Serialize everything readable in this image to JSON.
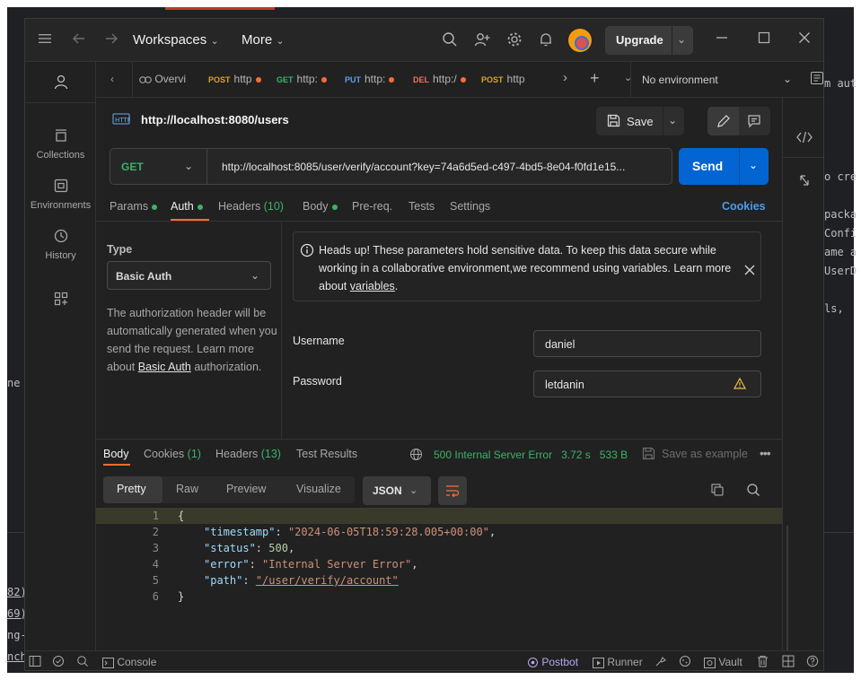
{
  "background_ide": {
    "fragments": [
      "m aut",
      "o cre",
      "packa",
      "Confi",
      "ame a",
      "UserD",
      "ls,",
      "ne",
      "82)",
      "69)",
      "ng-",
      "nch"
    ]
  },
  "titlebar": {
    "workspaces_label": "Workspaces",
    "more_label": "More",
    "upgrade_label": "Upgrade"
  },
  "sidebar": {
    "items": [
      {
        "label": "Collections",
        "icon": "collections-icon"
      },
      {
        "label": "Environments",
        "icon": "environments-icon"
      },
      {
        "label": "History",
        "icon": "history-icon"
      }
    ]
  },
  "tabs": [
    {
      "label": "Overvi",
      "method": ""
    },
    {
      "method": "POST",
      "label": "http",
      "method_color": "#d7a42a"
    },
    {
      "method": "GET",
      "label": "http:",
      "method_color": "#3bb36b"
    },
    {
      "method": "PUT",
      "label": "http:",
      "method_color": "#5f9fe8"
    },
    {
      "method": "DEL",
      "label": "http:/",
      "method_color": "#e8735f"
    },
    {
      "method": "POST",
      "label": "http",
      "method_color": "#d7a42a"
    }
  ],
  "environment": {
    "selected": "No environment"
  },
  "request": {
    "name": "http://localhost:8080/users",
    "method": "GET",
    "url": "http://localhost:8085/user/verify/account?key=74a6d5ed-c497-4bd5-8e04-f0fd1e15...",
    "save_label": "Save",
    "send_label": "Send"
  },
  "request_tabs": {
    "params": "Params",
    "auth": "Auth",
    "headers": "Headers",
    "headers_count": "(10)",
    "body": "Body",
    "prereq": "Pre-req.",
    "tests": "Tests",
    "settings": "Settings",
    "cookies": "Cookies"
  },
  "auth": {
    "type_label": "Type",
    "type_value": "Basic Auth",
    "desc_prefix": "The authorization header will be automatically generated when you send the request. Learn more about ",
    "desc_link": "Basic Auth",
    "desc_suffix": " authorization.",
    "warning_text": "Heads up! These parameters hold sensitive data. To keep this data secure while working in a collaborative environment,we recommend using variables. Learn more about ",
    "warning_link": "variables",
    "warning_end": ".",
    "username_label": "Username",
    "username_value": "daniel",
    "password_label": "Password",
    "password_value": "letdanin"
  },
  "response": {
    "tabs": {
      "body": "Body",
      "cookies": "Cookies",
      "cookies_count": "(1)",
      "headers": "Headers",
      "headers_count": "(13)",
      "test_results": "Test Results"
    },
    "status": "500 Internal Server Error",
    "time": "3.72 s",
    "size": "533 B",
    "save_example": "Save as example",
    "formats": [
      "Pretty",
      "Raw",
      "Preview",
      "Visualize"
    ],
    "language": "JSON",
    "lines": [
      {
        "n": "1",
        "text": "{"
      },
      {
        "n": "2",
        "key": "\"timestamp\"",
        "value": "\"2024-06-05T18:59:28.005+00:00\"",
        "trail": ","
      },
      {
        "n": "3",
        "key": "\"status\"",
        "value": "500",
        "trail": ","
      },
      {
        "n": "4",
        "key": "\"error\"",
        "value": "\"Internal Server Error\"",
        "trail": ","
      },
      {
        "n": "5",
        "key": "\"path\"",
        "value": "\"/user/verify/account\"",
        "trail": ""
      },
      {
        "n": "6",
        "text": "}"
      }
    ]
  },
  "statusbar": {
    "console": "Console",
    "postbot": "Postbot",
    "runner": "Runner",
    "vault": "Vault"
  }
}
